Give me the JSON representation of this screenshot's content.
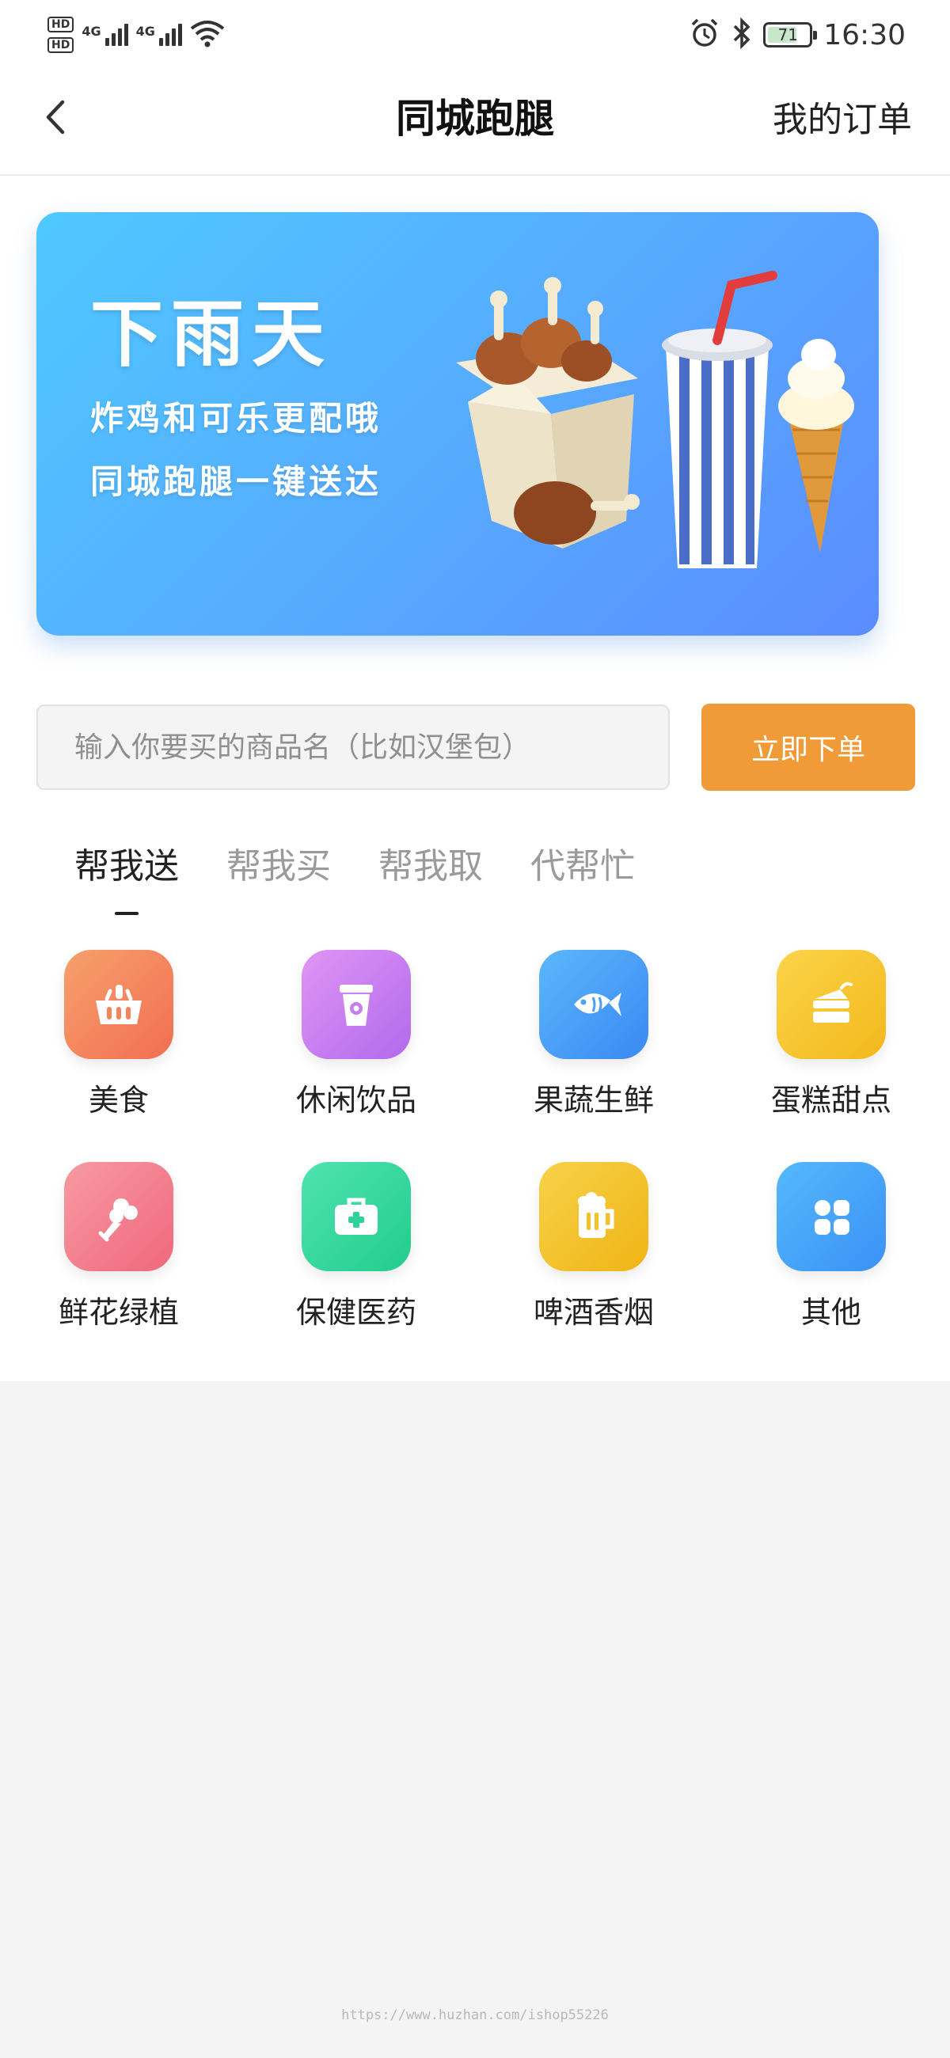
{
  "status_bar": {
    "hd_badge": "HD",
    "network_1": "4G",
    "network_2": "4G",
    "battery_level": "71",
    "time": "16:30",
    "icons": [
      "signal-icon",
      "wifi-icon",
      "alarm-icon",
      "bluetooth-icon",
      "battery-icon"
    ]
  },
  "nav": {
    "back_icon": "chevron-left-icon",
    "title": "同城跑腿",
    "right_link": "我的订单"
  },
  "banner": {
    "headline": "下雨天",
    "line1": "炸鸡和可乐更配哦",
    "line2": "同城跑腿一键送达"
  },
  "search": {
    "placeholder": "输入你要买的商品名（比如汉堡包）",
    "value": "",
    "submit_label": "立即下单"
  },
  "tabs": [
    {
      "label": "帮我送",
      "active": true
    },
    {
      "label": "帮我买",
      "active": false
    },
    {
      "label": "帮我取",
      "active": false
    },
    {
      "label": "代帮忙",
      "active": false
    }
  ],
  "categories": [
    {
      "label": "美食",
      "icon": "basket-icon",
      "color": "#f5865f"
    },
    {
      "label": "休闲饮品",
      "icon": "cup-icon",
      "color": "#c580f0"
    },
    {
      "label": "果蔬生鲜",
      "icon": "fish-icon",
      "color": "#4a9ff8"
    },
    {
      "label": "蛋糕甜点",
      "icon": "cake-icon",
      "color": "#f6c731"
    },
    {
      "label": "鲜花绿植",
      "icon": "bouquet-icon",
      "color": "#f47e8b"
    },
    {
      "label": "保健医药",
      "icon": "medkit-icon",
      "color": "#34d9a0"
    },
    {
      "label": "啤酒香烟",
      "icon": "beer-icon",
      "color": "#f2c126"
    },
    {
      "label": "其他",
      "icon": "grid-icon",
      "color": "#46a6fb"
    }
  ],
  "watermark": "https://www.huzhan.com/ishop55226",
  "colors": {
    "accent": "#f19a38",
    "banner_start": "#4fc8ff",
    "banner_end": "#5b8cff",
    "page_bg": "#f4f4f4"
  }
}
